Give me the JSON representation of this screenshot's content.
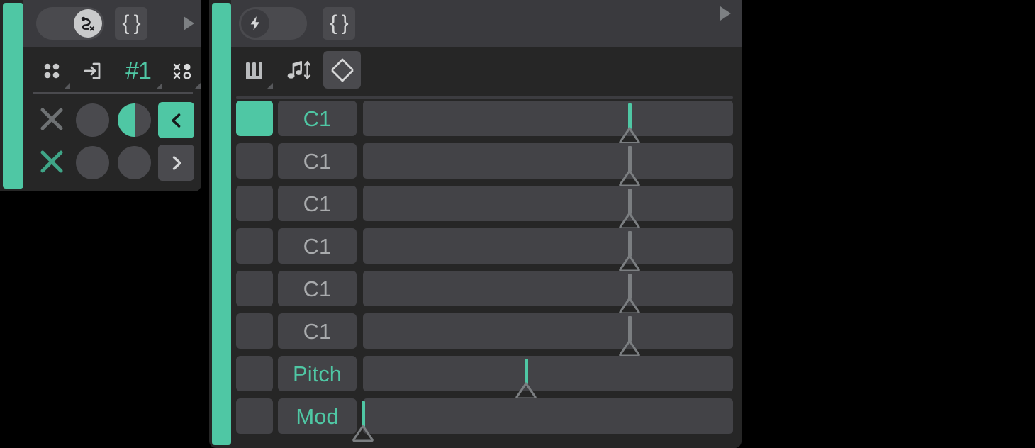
{
  "theme": {
    "accent": "#4fc7a4",
    "panel_bg": "#262626",
    "header_bg": "#3a3a3e",
    "control_bg": "#4a4a4e",
    "row_bg": "#434347",
    "text_gray": "#a9abad"
  },
  "left_panel": {
    "name": "routing-panel",
    "header": {
      "toggle": {
        "name": "routing-toggle",
        "state": "on",
        "icon": "route-off-icon"
      },
      "braces_button": {
        "label": "{ }",
        "icon": "curly-braces-icon"
      },
      "expand_button": {
        "icon": "play-triangle-icon"
      }
    },
    "toolbar": {
      "items": [
        {
          "name": "grid-dots-icon",
          "label": "",
          "has_menu": true
        },
        {
          "name": "enter-arrow-icon",
          "label": "",
          "has_menu": false
        },
        {
          "name": "channel-number",
          "label": "#1",
          "has_menu": true
        },
        {
          "name": "mixed-dots-cross-icon",
          "label": "",
          "has_menu": true
        }
      ]
    },
    "controls": {
      "row1": [
        {
          "name": "clear-x-icon",
          "state": "inactive"
        },
        {
          "name": "knob-empty",
          "state": "inactive"
        },
        {
          "name": "knob-half-filled",
          "state": "half"
        },
        {
          "name": "prev-button",
          "label": "‹",
          "state": "active"
        }
      ],
      "row2": [
        {
          "name": "clear-x-icon",
          "state": "active"
        },
        {
          "name": "knob-empty",
          "state": "inactive"
        },
        {
          "name": "knob-empty",
          "state": "inactive"
        },
        {
          "name": "next-button",
          "label": "›",
          "state": "inactive"
        }
      ]
    }
  },
  "right_panel": {
    "name": "mod-matrix-panel",
    "header": {
      "toggle": {
        "name": "power-toggle",
        "state": "off",
        "icon": "lightning-bolt-icon"
      },
      "braces_button": {
        "label": "{ }",
        "icon": "curly-braces-icon"
      },
      "expand_button": {
        "icon": "play-triangle-icon"
      }
    },
    "toolbar": {
      "items": [
        {
          "name": "piano-keys-icon",
          "selected": false,
          "has_menu": true
        },
        {
          "name": "note-updown-icon",
          "selected": false,
          "has_menu": false
        },
        {
          "name": "chevron-updown-diamond-icon",
          "selected": true,
          "has_menu": false
        }
      ]
    },
    "rows": [
      {
        "label": "C1",
        "selected": true,
        "label_color": "accent",
        "slider_percent": 72,
        "slider_accent": true
      },
      {
        "label": "C1",
        "selected": false,
        "label_color": "gray",
        "slider_percent": 72,
        "slider_accent": false
      },
      {
        "label": "C1",
        "selected": false,
        "label_color": "gray",
        "slider_percent": 72,
        "slider_accent": false
      },
      {
        "label": "C1",
        "selected": false,
        "label_color": "gray",
        "slider_percent": 72,
        "slider_accent": false
      },
      {
        "label": "C1",
        "selected": false,
        "label_color": "gray",
        "slider_percent": 72,
        "slider_accent": false
      },
      {
        "label": "C1",
        "selected": false,
        "label_color": "gray",
        "slider_percent": 72,
        "slider_accent": false
      },
      {
        "label": "Pitch",
        "selected": false,
        "label_color": "accent",
        "slider_percent": 44,
        "slider_accent": true
      },
      {
        "label": "Mod",
        "selected": false,
        "label_color": "accent",
        "slider_percent": 0,
        "slider_accent": true
      }
    ]
  }
}
